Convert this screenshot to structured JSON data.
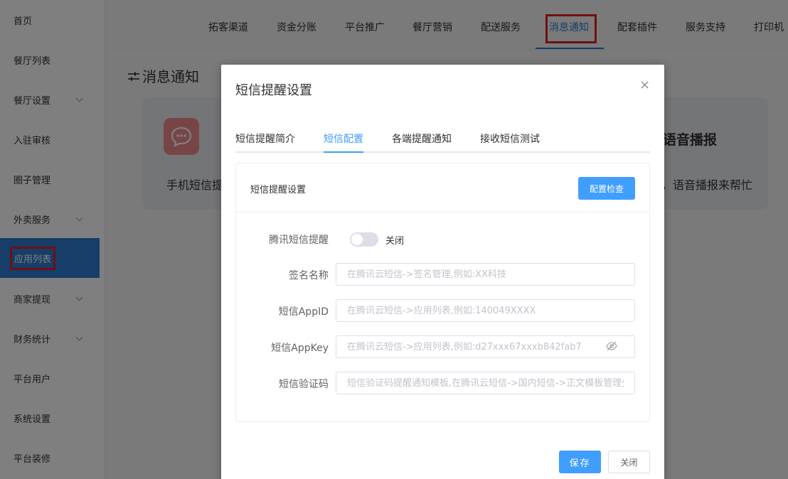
{
  "sidebar": {
    "items": [
      {
        "label": "首页",
        "has_children": false
      },
      {
        "label": "餐厅列表",
        "has_children": false
      },
      {
        "label": "餐厅设置",
        "has_children": true
      },
      {
        "label": "入驻审核",
        "has_children": false
      },
      {
        "label": "圈子管理",
        "has_children": false
      },
      {
        "label": "外卖服务",
        "has_children": true
      },
      {
        "label": "应用列表",
        "has_children": false,
        "active": true
      },
      {
        "label": "商家提现",
        "has_children": true
      },
      {
        "label": "财务统计",
        "has_children": true
      },
      {
        "label": "平台用户",
        "has_children": false
      },
      {
        "label": "系统设置",
        "has_children": false
      },
      {
        "label": "平台装修",
        "has_children": false
      }
    ]
  },
  "topnav": {
    "tabs": [
      "拓客渠道",
      "资金分账",
      "平台推广",
      "餐厅营销",
      "配送服务",
      "消息通知",
      "配套插件",
      "服务支持",
      "打印机"
    ],
    "active_index": 5
  },
  "page": {
    "title": "消息通知",
    "title_icon": "sliders-icon",
    "card_text_left": "手机短信提",
    "card_title_right": "语音播报",
    "card_text_right": "，语音播报来帮忙"
  },
  "dialog": {
    "title": "短信提醒设置",
    "close_symbol": "×",
    "tabs": [
      "短信提醒简介",
      "短信配置",
      "各端提醒通知",
      "接收短信测试"
    ],
    "active_tab": 1,
    "panel": {
      "title": "短信提醒设置",
      "check_button": "配置检查",
      "switch": {
        "label": "腾讯短信提醒",
        "state_text": "关闭",
        "on": false
      },
      "fields": [
        {
          "label": "签名名称",
          "value": "",
          "placeholder": "在腾讯云短信->签名管理,例如:XX科技"
        },
        {
          "label": "短信AppID",
          "value": "",
          "placeholder": "在腾讯云短信->应用列表,例如:140049XXXX"
        },
        {
          "label": "短信AppKey",
          "value": "",
          "placeholder": "在腾讯云短信->应用列表,例如:d27xxx67xxxb842fab7"
        },
        {
          "label": "短信验证码",
          "value": "",
          "placeholder": "短信验证码提醒通知模板,在腾讯云短信->国内短信->正文模板管理处"
        }
      ]
    },
    "save_button": "保存",
    "close_button": "关闭"
  },
  "colors": {
    "primary": "#409eff",
    "sidebar_active": "#2f7bd3",
    "highlight_box": "#e02020",
    "card_icon": "#f08a8f"
  }
}
